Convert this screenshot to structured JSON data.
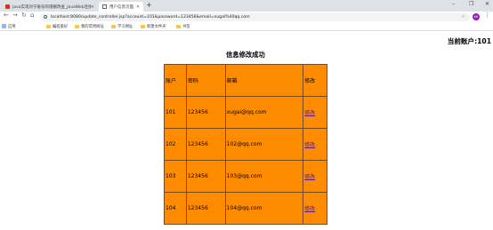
{
  "browser": {
    "tabs": [
      {
        "title": "Java实现对于账号的增删改查_JavaWeb连接MySQL的教程",
        "active": false
      },
      {
        "title": "用户信息页面",
        "active": true
      }
    ],
    "new_tab_glyph": "+",
    "window_controls": {
      "minimize": "–",
      "maximize": "❐",
      "close": "✕"
    },
    "url": "localhost:8080/update_controller.jsp?account=101&password=123456&email=xugai%40qq.com",
    "avatar_text": "KK",
    "bookmarks": [
      "应用",
      "编程爱好",
      "我的常用网址",
      "学习网址",
      "新建文件夹",
      "书签"
    ]
  },
  "page": {
    "account_label": "当前账户:101",
    "heading": "信息修改成功",
    "table": {
      "headers": [
        "账户",
        "密码",
        "邮箱",
        "修改"
      ],
      "rows": [
        [
          "101",
          "123456",
          "xugai@qq.com",
          "修改"
        ],
        [
          "102",
          "123456",
          "102@qq.com",
          "修改"
        ],
        [
          "103",
          "123456",
          "103@qq.com",
          "修改"
        ],
        [
          "104",
          "123456",
          "104@qq.com",
          "修改"
        ]
      ]
    }
  },
  "colors": {
    "table_background": "#ff8c00",
    "table_border": "#7a4a1a",
    "link": "#551a8b",
    "avatar": "#8e24aa"
  }
}
